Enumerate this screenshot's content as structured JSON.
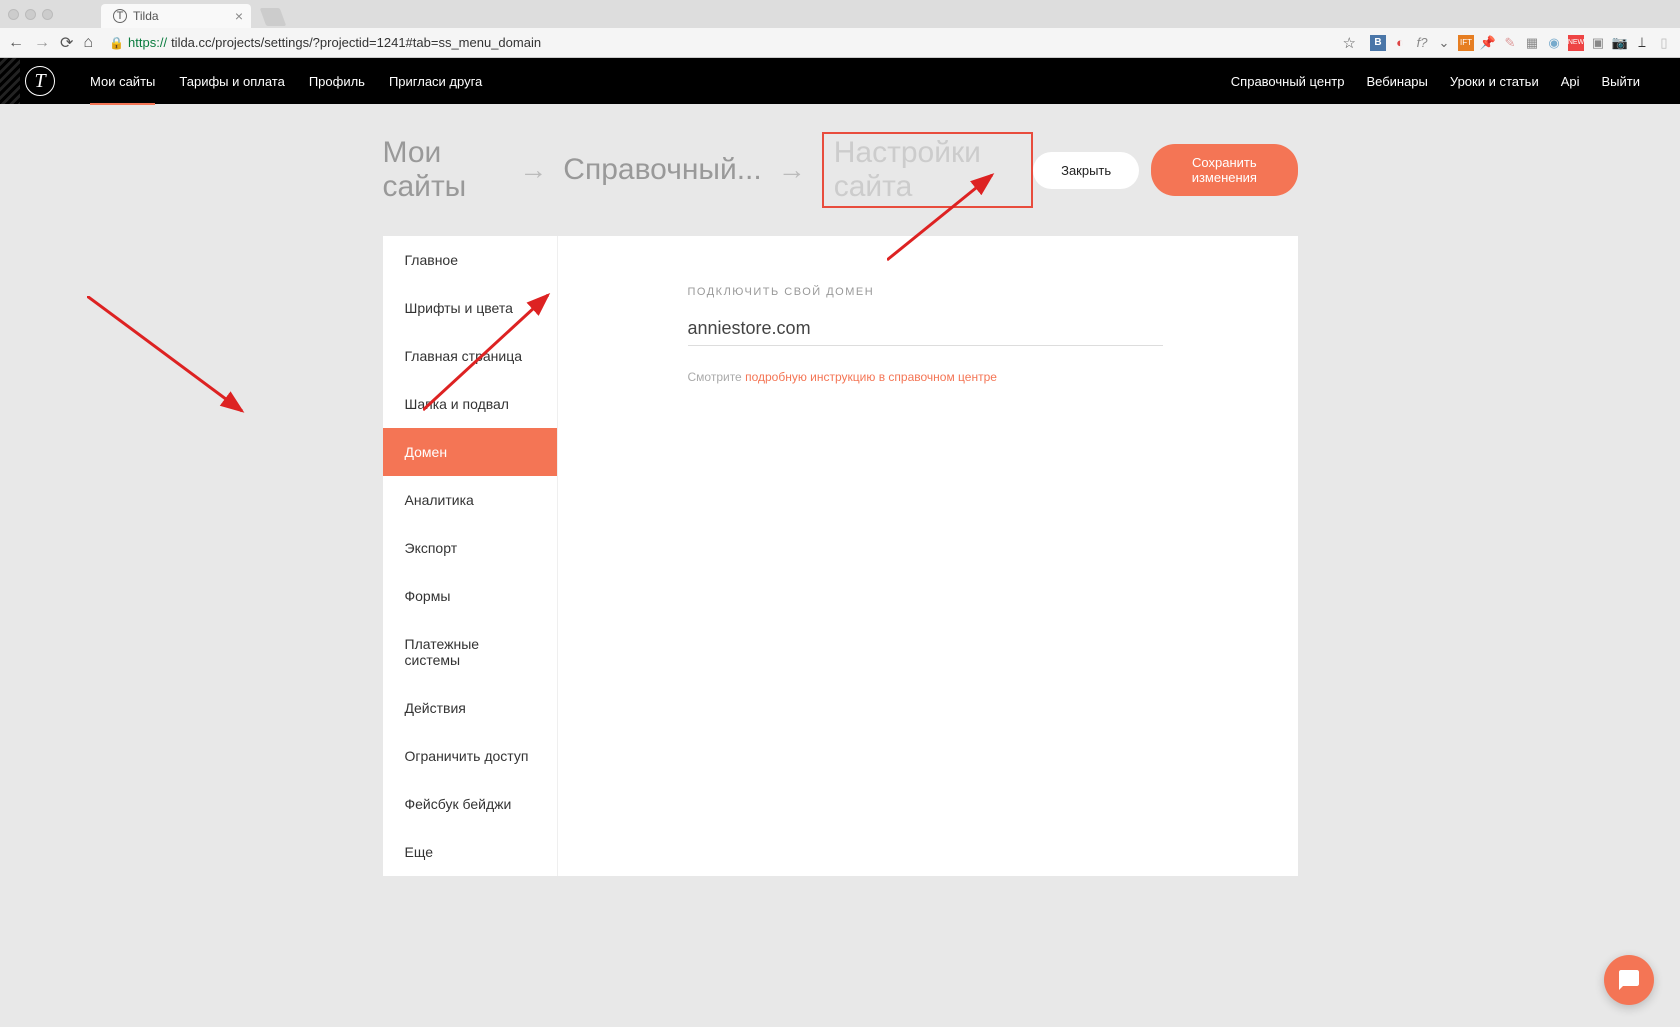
{
  "browser": {
    "tab_title": "Tilda",
    "url_protocol": "https://",
    "url": "tilda.cc/projects/settings/?projectid=1241#tab=ss_menu_domain"
  },
  "header": {
    "main_nav": [
      "Мои сайты",
      "Тарифы и оплата",
      "Профиль",
      "Пригласи друга"
    ],
    "right_nav": [
      "Справочный центр",
      "Вебинары",
      "Уроки и статьи",
      "Api",
      "Выйти"
    ]
  },
  "breadcrumbs": {
    "crumb1": "Мои сайты",
    "crumb2": "Справочный...",
    "crumb3": "Настройки сайта"
  },
  "actions": {
    "close": "Закрыть",
    "save": "Сохранить изменения"
  },
  "sidebar": {
    "items": [
      {
        "label": "Главное"
      },
      {
        "label": "Шрифты и цвета"
      },
      {
        "label": "Главная страница"
      },
      {
        "label": "Шапка и подвал"
      },
      {
        "label": "Домен"
      },
      {
        "label": "Аналитика"
      },
      {
        "label": "Экспорт"
      },
      {
        "label": "Формы"
      },
      {
        "label": "Платежные системы"
      },
      {
        "label": "Действия"
      },
      {
        "label": "Ограничить доступ"
      },
      {
        "label": "Фейсбук бейджи"
      },
      {
        "label": "Еще"
      }
    ]
  },
  "content": {
    "field_label": "ПОДКЛЮЧИТЬ СВОЙ ДОМЕН",
    "domain_value": "anniestore.com",
    "help_prefix": "Смотрите ",
    "help_link": "подробную инструкцию в справочном центре"
  },
  "colors": {
    "accent": "#f47555",
    "highlight_border": "#e84c3d"
  }
}
